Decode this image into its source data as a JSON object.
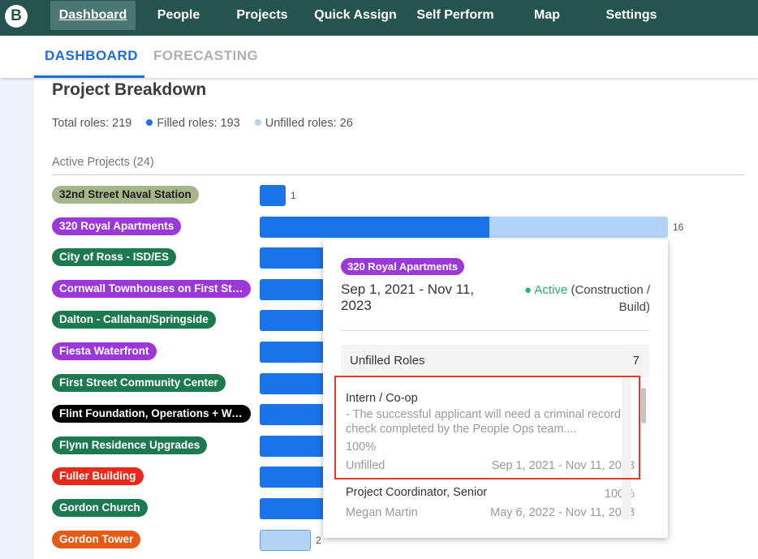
{
  "nav": {
    "logo": "B",
    "items": [
      {
        "label": "Dashboard",
        "active": true
      },
      {
        "label": "People"
      },
      {
        "label": "Projects"
      },
      {
        "label": "Quick Assign"
      },
      {
        "label": "Self Perform"
      },
      {
        "label": "Map"
      },
      {
        "label": "Settings"
      }
    ]
  },
  "tabs": {
    "dashboard": "DASHBOARD",
    "forecasting": "FORECASTING"
  },
  "breakdown": {
    "title": "Project Breakdown",
    "total": "Total roles: 219",
    "filled": "Filled roles: 193",
    "unfilled": "Unfilled roles: 26",
    "active_label": "Active Projects (24)"
  },
  "colors": {
    "filled": "#1a73e8",
    "unfilled": "#b3d3f6",
    "accent": "#1e6bd6",
    "nav_bg": "#25544f"
  },
  "projects": [
    {
      "name": "32nd Street Naval Station",
      "color": "#a7b58a",
      "text": "#1d1d1d",
      "filled": 1,
      "unfilled": 0,
      "count": "1"
    },
    {
      "name": "320 Royal Apartments",
      "color": "#9b38d8",
      "text": "#ffffff",
      "filled": 9,
      "unfilled": 7,
      "count": "16"
    },
    {
      "name": "City of Ross - ISD/ES",
      "color": "#1d7a50",
      "text": "#ffffff"
    },
    {
      "name": "Cornwall Townhouses on First Str...",
      "color": "#9b38d8",
      "text": "#ffffff"
    },
    {
      "name": "Dalton - Callahan/Springside",
      "color": "#1d7a50",
      "text": "#ffffff"
    },
    {
      "name": "Fiesta Waterfront",
      "color": "#9b38d8",
      "text": "#ffffff"
    },
    {
      "name": "First Street Community Center",
      "color": "#1d7a50",
      "text": "#ffffff"
    },
    {
      "name": "Flint Foundation, Operations + Wa...",
      "color": "#000000",
      "text": "#ffffff"
    },
    {
      "name": "Flynn Residence Upgrades",
      "color": "#1d7a50",
      "text": "#ffffff"
    },
    {
      "name": "Fuller Building",
      "color": "#e8291c",
      "text": "#ffffff"
    },
    {
      "name": "Gordon Church",
      "color": "#1d7a50",
      "text": "#ffffff"
    },
    {
      "name": "Gordon Tower",
      "color": "#e55a14",
      "text": "#ffffff",
      "filled": 0,
      "unfilled": 2,
      "count": "2"
    }
  ],
  "popup": {
    "project": "320 Royal Apartments",
    "dates": "Sep 1, 2021 - Nov 11, 2023",
    "status_active": "● Active",
    "status_phase": "(Construction / Build)",
    "unfilled_label": "Unfilled Roles",
    "unfilled_count": "7",
    "roles": [
      {
        "title": "Intern / Co-op",
        "desc": "- The successful applicant will need a criminal record check completed by the People Ops team....",
        "pct": "100%",
        "status": "Unfilled",
        "dates": "Sep 1, 2021 - Nov 11, 2023"
      },
      {
        "title": "Project Coordinator, Senior",
        "pct": "100%",
        "status": "Megan Martin",
        "dates": "May 6, 2022 - Nov 11, 2023"
      }
    ]
  }
}
